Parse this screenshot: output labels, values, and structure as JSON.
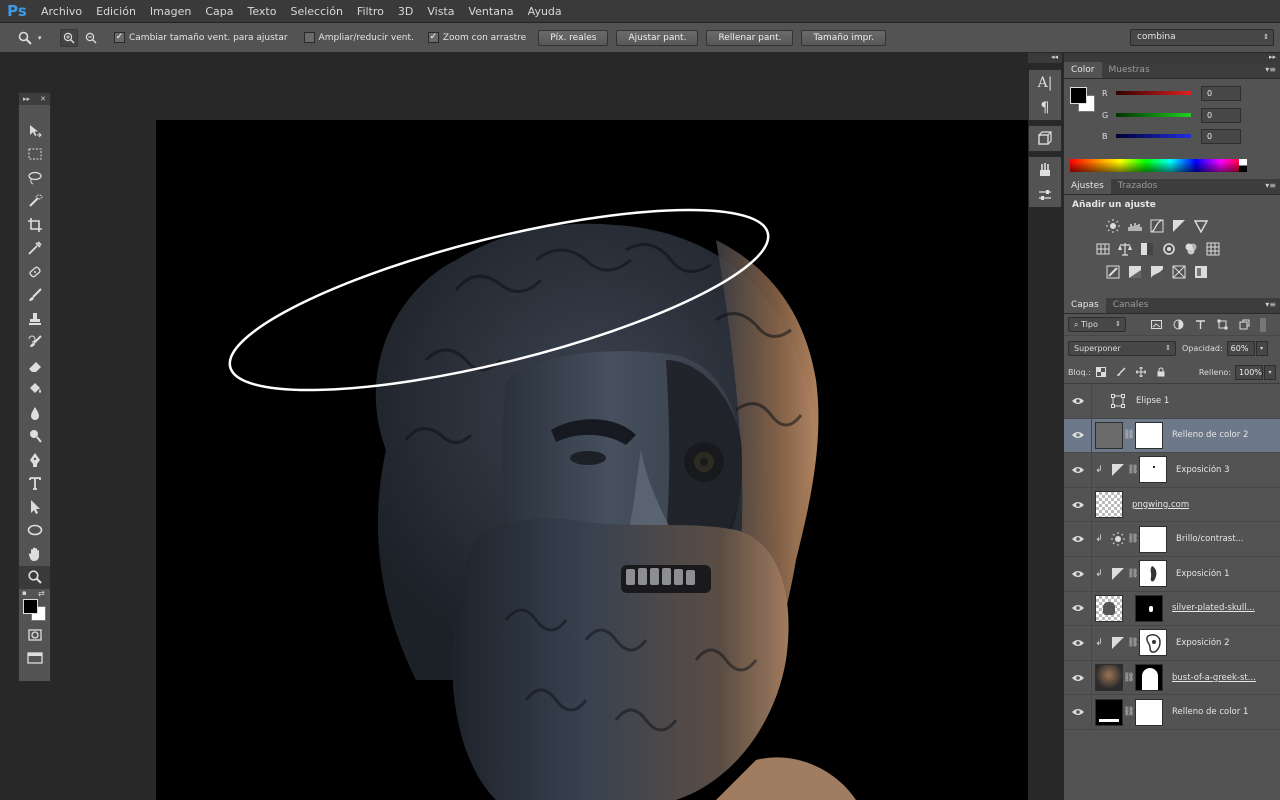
{
  "app": {
    "logo": "Ps"
  },
  "menu": [
    "Archivo",
    "Edición",
    "Imagen",
    "Capa",
    "Texto",
    "Selección",
    "Filtro",
    "3D",
    "Vista",
    "Ventana",
    "Ayuda"
  ],
  "options": {
    "resize_windows": {
      "label": "Cambiar tamaño vent. para ajustar",
      "checked": true
    },
    "zoom_all": {
      "label": "Ampliar/reducir vent.",
      "checked": false
    },
    "scrubby_zoom": {
      "label": "Zoom con arrastre",
      "checked": true
    },
    "buttons": [
      "Píx. reales",
      "Ajustar pant.",
      "Rellenar pant.",
      "Tamaño impr."
    ],
    "workspace": "combina"
  },
  "color_panel": {
    "tabs": [
      "Color",
      "Muestras"
    ],
    "channels": [
      {
        "label": "R",
        "value": "0",
        "color": "#d11d1d"
      },
      {
        "label": "G",
        "value": "0",
        "color": "#1ccf1c"
      },
      {
        "label": "B",
        "value": "0",
        "color": "#1c2fd8"
      }
    ]
  },
  "adjustments_panel": {
    "tabs": [
      "Ajustes",
      "Trazados"
    ],
    "title": "Añadir un ajuste"
  },
  "layers_panel": {
    "tabs": [
      "Capas",
      "Canales"
    ],
    "filter_kind": "Tipo",
    "blend_mode": "Superponer",
    "opacity_label": "Opacidad:",
    "opacity": "60%",
    "lock_label": "Bloq.:",
    "fill_label": "Relleno:",
    "fill": "100%",
    "layers": [
      {
        "name": "Elipse 1",
        "kind": "shape",
        "selected": false,
        "clipped": false,
        "underline": false
      },
      {
        "name": "Relleno de color 2",
        "kind": "fill-gray",
        "selected": true,
        "clipped": false,
        "underline": false
      },
      {
        "name": "Exposición 3",
        "kind": "adjust",
        "selected": false,
        "clipped": true,
        "underline": false
      },
      {
        "name": "pngwing.com",
        "kind": "pixel",
        "selected": false,
        "clipped": false,
        "underline": true
      },
      {
        "name": "Brillo/contrast...",
        "kind": "brightness",
        "selected": false,
        "clipped": true,
        "underline": false
      },
      {
        "name": "Exposición 1",
        "kind": "adjust",
        "selected": false,
        "clipped": true,
        "underline": false
      },
      {
        "name": "silver-plated-skull...",
        "kind": "pixel-mask",
        "selected": false,
        "clipped": false,
        "underline": true
      },
      {
        "name": "Exposición 2",
        "kind": "adjust",
        "selected": false,
        "clipped": true,
        "underline": false
      },
      {
        "name": "bust-of-a-greek-st...",
        "kind": "photo-mask",
        "selected": false,
        "clipped": false,
        "underline": true
      },
      {
        "name": "Relleno de color 1",
        "kind": "fill-black",
        "selected": false,
        "clipped": false,
        "underline": false
      }
    ]
  },
  "colors": {
    "foreground": "#000000",
    "background": "#ffffff",
    "selection_highlight": "#6d7888"
  }
}
